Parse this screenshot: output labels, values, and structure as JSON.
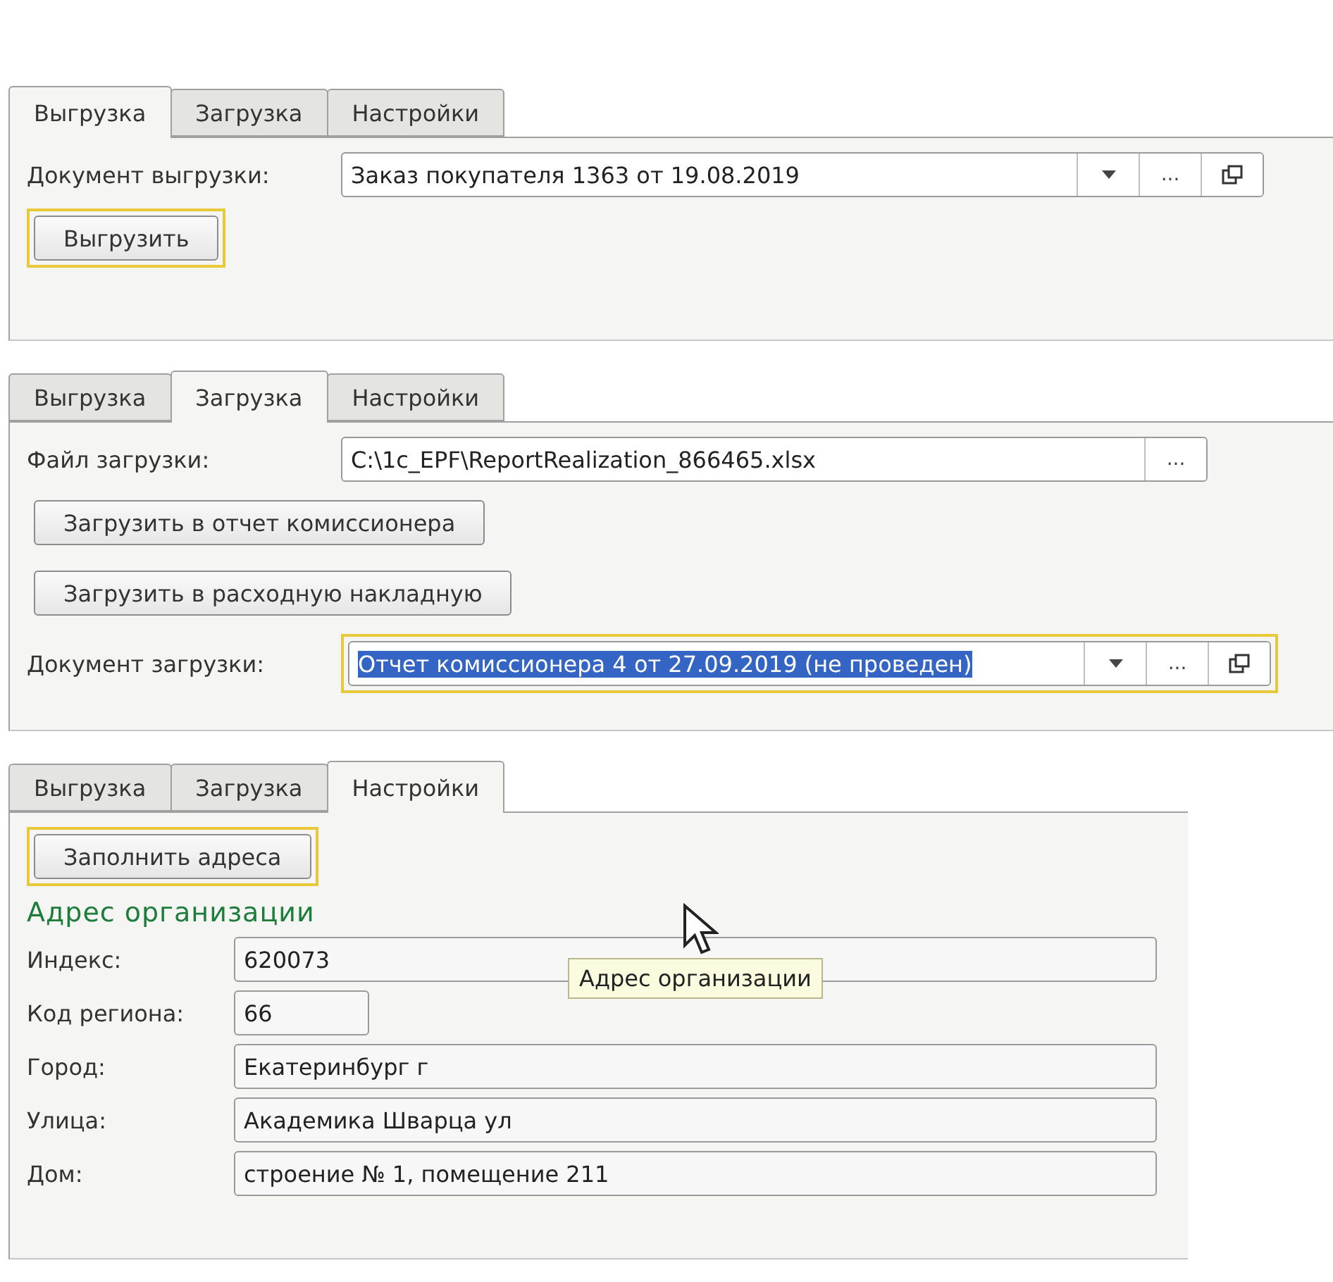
{
  "panels": [
    {
      "tabs": [
        {
          "label": "Выгрузка",
          "selected": true
        },
        {
          "label": "Загрузка",
          "selected": false
        },
        {
          "label": "Настройки",
          "selected": false
        }
      ],
      "rows": [
        {
          "kind": "select",
          "label": "Документ выгрузки:",
          "value": "Заказ покупателя 1363 от 19.08.2019",
          "ellipsis": "...",
          "focused": false,
          "text_selected": false
        },
        {
          "kind": "button",
          "label": "Выгрузить",
          "focused": true
        }
      ]
    },
    {
      "tabs": [
        {
          "label": "Выгрузка",
          "selected": false
        },
        {
          "label": "Загрузка",
          "selected": true
        },
        {
          "label": "Настройки",
          "selected": false
        }
      ],
      "rows": [
        {
          "kind": "file",
          "label": "Файл загрузки:",
          "value": "C:\\1c_EPF\\ReportRealization_866465.xlsx",
          "ellipsis": "..."
        },
        {
          "kind": "button",
          "label": "Загрузить в отчет комиссионера",
          "focused": false
        },
        {
          "kind": "button",
          "label": "Загрузить в расходную накладную",
          "focused": false
        },
        {
          "kind": "select",
          "label": "Документ загрузки:",
          "value": "Отчет комиссионера 4 от 27.09.2019 (не проведен)",
          "ellipsis": "...",
          "focused": true,
          "text_selected": true
        }
      ]
    },
    {
      "tabs": [
        {
          "label": "Выгрузка",
          "selected": false
        },
        {
          "label": "Загрузка",
          "selected": false
        },
        {
          "label": "Настройки",
          "selected": true
        }
      ],
      "tooltip": "Адрес организации",
      "rows": [
        {
          "kind": "button",
          "label": "Заполнить адреса",
          "focused": true
        },
        {
          "kind": "heading",
          "label": "Адрес организации"
        },
        {
          "kind": "field",
          "label": "Индекс:",
          "value": "620073"
        },
        {
          "kind": "short_field",
          "label": "Код региона:",
          "value": "66"
        },
        {
          "kind": "field",
          "label": "Город:",
          "value": "Екатеринбург г"
        },
        {
          "kind": "field",
          "label": "Улица:",
          "value": "Академика Шварца ул"
        },
        {
          "kind": "field",
          "label": "Дом:",
          "value": "строение № 1, помещение 211"
        }
      ]
    }
  ]
}
